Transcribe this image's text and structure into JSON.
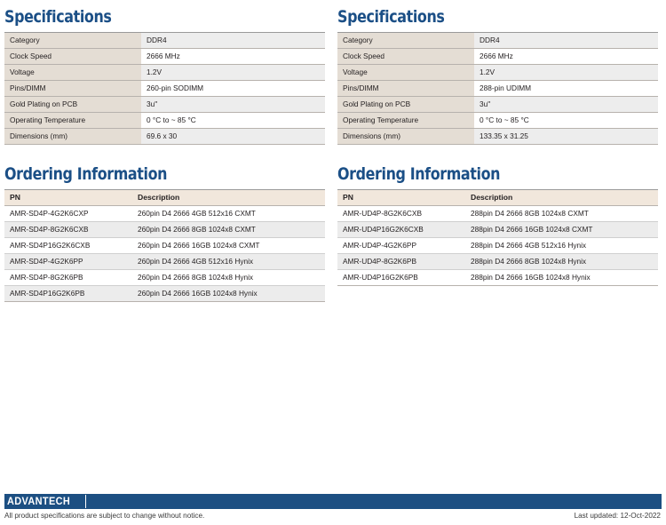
{
  "columns": [
    {
      "specs": {
        "title": "Specifications",
        "rows": [
          {
            "label": "Category",
            "value": "DDR4"
          },
          {
            "label": "Clock Speed",
            "value": "2666 MHz"
          },
          {
            "label": "Voltage",
            "value": "1.2V"
          },
          {
            "label": "Pins/DIMM",
            "value": "260-pin SODIMM"
          },
          {
            "label": "Gold Plating on PCB",
            "value": "3u\""
          },
          {
            "label": "Operating Temperature",
            "value": "0 °C to ~ 85 °C"
          },
          {
            "label": "Dimensions (mm)",
            "value": "69.6 x 30"
          }
        ]
      },
      "ordering": {
        "title": "Ordering Information",
        "headers": {
          "pn": "PN",
          "description": "Description"
        },
        "rows": [
          {
            "pn": "AMR-SD4P-4G2K6CXP",
            "description": "260pin D4 2666 4GB  512x16 CXMT"
          },
          {
            "pn": "AMR-SD4P-8G2K6CXB",
            "description": "260pin D4 2666 8GB 1024x8 CXMT"
          },
          {
            "pn": "AMR-SD4P16G2K6CXB",
            "description": "260pin D4 2666 16GB 1024x8 CXMT"
          },
          {
            "pn": "AMR-SD4P-4G2K6PP",
            "description": "260pin D4 2666 4GB 512x16 Hynix"
          },
          {
            "pn": "AMR-SD4P-8G2K6PB",
            "description": "260pin D4 2666 8GB 1024x8 Hynix"
          },
          {
            "pn": "AMR-SD4P16G2K6PB",
            "description": "260pin D4 2666 16GB 1024x8 Hynix"
          }
        ]
      }
    },
    {
      "specs": {
        "title": "Specifications",
        "rows": [
          {
            "label": "Category",
            "value": "DDR4"
          },
          {
            "label": "Clock Speed",
            "value": "2666 MHz"
          },
          {
            "label": "Voltage",
            "value": "1.2V"
          },
          {
            "label": "Pins/DIMM",
            "value": "288-pin UDIMM"
          },
          {
            "label": "Gold Plating on PCB",
            "value": "3u\""
          },
          {
            "label": "Operating Temperature",
            "value": "0 °C to ~ 85 °C"
          },
          {
            "label": "Dimensions (mm)",
            "value": "133.35 x 31.25"
          }
        ]
      },
      "ordering": {
        "title": "Ordering Information",
        "headers": {
          "pn": "PN",
          "description": "Description"
        },
        "rows": [
          {
            "pn": "AMR-UD4P-8G2K6CXB",
            "description": "288pin D4 2666 8GB 1024x8 CXMT"
          },
          {
            "pn": "AMR-UD4P16G2K6CXB",
            "description": "288pin D4 2666 16GB 1024x8 CXMT"
          },
          {
            "pn": "AMR-UD4P-4G2K6PP",
            "description": "288pin D4 2666 4GB 512x16 Hynix"
          },
          {
            "pn": "AMR-UD4P-8G2K6PB",
            "description": "288pin D4 2666 8GB 1024x8 Hynix"
          },
          {
            "pn": "AMR-UD4P16G2K6PB",
            "description": "288pin D4 2666 16GB 1024x8 Hynix"
          }
        ]
      }
    }
  ],
  "footer": {
    "logo_text": "ADVANTECH",
    "note": "All product specifications are subject to change without notice.",
    "last_updated": "Last updated: 12-Oct-2022"
  },
  "colors": {
    "heading_blue": "#1b4f86",
    "footer_bar": "#1c4f82",
    "spec_label_bg": "#e4ddd4",
    "order_header_bg": "#f1e7dc",
    "stripe_gray": "#ececec"
  }
}
